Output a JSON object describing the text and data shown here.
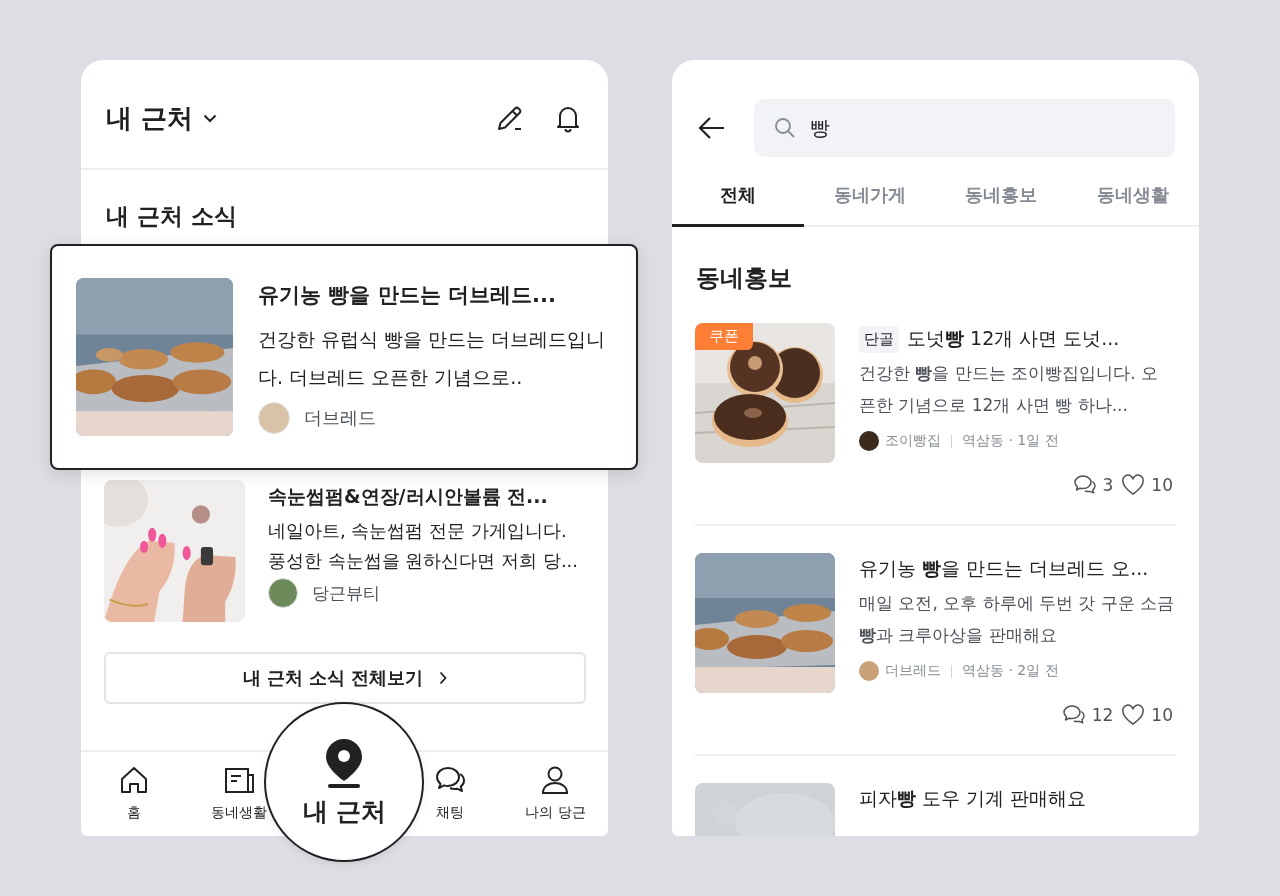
{
  "left": {
    "header": {
      "title": "내 근처"
    },
    "section_title": "내 근처 소식",
    "featured": {
      "title": "유기농 빵을 만드는 더브레드...",
      "description": "건강한 유럽식 빵을 만드는 더브레드입니다. 더브레드 오픈한 기념으로..",
      "author": "더브레드"
    },
    "posts": [
      {
        "title": "속눈썹펌&연장/러시안볼륨 전...",
        "description": "네일아트, 속눈썹펌 전문 가게입니다. 풍성한 속눈썹을 원하신다면 저희 당...",
        "author": "당근뷰티"
      }
    ],
    "more_button": "내 근처 소식 전체보기",
    "nav": [
      {
        "label": "홈",
        "selected": false
      },
      {
        "label": "동네생활",
        "selected": false
      },
      {
        "label": "내 근처",
        "selected": true
      },
      {
        "label": "채팅",
        "selected": false
      },
      {
        "label": "나의 당근",
        "selected": false
      }
    ]
  },
  "right": {
    "search": {
      "value": "빵"
    },
    "tabs": [
      {
        "label": "전체",
        "selected": true
      },
      {
        "label": "동네가게",
        "selected": false
      },
      {
        "label": "동네홍보",
        "selected": false
      },
      {
        "label": "동네생활",
        "selected": false
      }
    ],
    "section_title": "동네홍보",
    "results": [
      {
        "badge": "쿠폰",
        "tag": "단골",
        "title": "도넛**빵** 12개 사면 도넛...",
        "description": "건강한 **빵**을 만드는 조이빵집입니다. 오픈한 기념으로 12개 사면 빵 하나...",
        "store": "조이빵집",
        "location": "역삼동 · 1일 전",
        "comments": "3",
        "likes": "10"
      },
      {
        "title": "유기농 **빵**을 만드는 더브레드 오...",
        "description": "매일 오전, 오후 하루에 두번 갓 구운 소금 **빵**과 크루아상을 판매해요",
        "store": "더브레드",
        "location": "역삼동 · 2일 전",
        "comments": "12",
        "likes": "10"
      },
      {
        "title": "피자**빵** 도우 기계 판매해요"
      }
    ]
  }
}
